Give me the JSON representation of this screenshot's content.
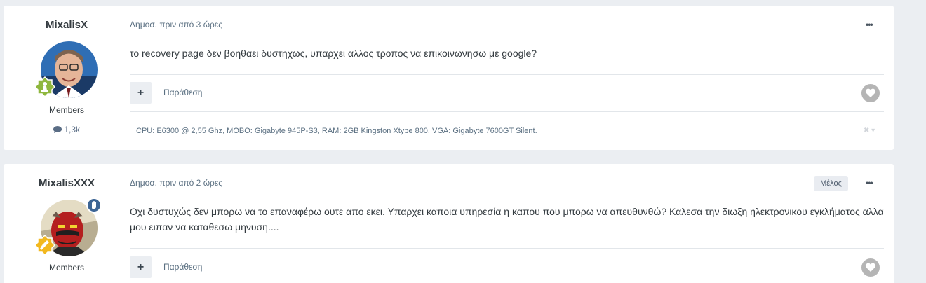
{
  "posts": [
    {
      "author": "MixalisX",
      "group": "Members",
      "post_count": "1,3k",
      "time": "Δημοσ. πριν από 3 ώρες",
      "content": "το recovery page δεν βοηθαει  δυστηχως, υπαρχει αλλος τροπος να επικοινωνησω με google?",
      "quote_label": "Παράθεση",
      "plus_label": "+",
      "menu_label": "•••",
      "signature": "CPU: E6300 @ 2,55 Ghz, MOBO: Gigabyte 945P-S3, RAM: 2GB Kingston Xtype 800, VGA: Gigabyte 7600GT Silent.",
      "signature_ctrl": "✖ ▾"
    },
    {
      "author": "MixalisXXX",
      "group": "Members",
      "time": "Δημοσ. πριν από 2 ώρες",
      "member_tag": "Μέλος",
      "content": "Οχι δυστυχώς  δεν μπορω να το επαναφέρω  ουτε απο εκει. Υπαρχει  καποια υπηρεσία  η καπου που μπορω να απευθυνθώ? Καλεσα την διωξη ηλεκτρονικου εγκλήματος  αλλα μου ειπαν να καταθεσω μηνυση....",
      "quote_label": "Παράθεση",
      "plus_label": "+",
      "menu_label": "•••"
    }
  ],
  "colors": {
    "page_bg": "#ebeef2",
    "card_bg": "#ffffff",
    "rank_green": "#8fb73e",
    "rank_gold": "#f2b81f",
    "staff_blue": "#3d6594",
    "like_grey": "#b5b5b5"
  },
  "icons": {
    "like": "heart-icon",
    "post_count": "comment-icon",
    "rank1": "chess-pawn-icon",
    "rank2": "brush-icon",
    "staff": "hand-icon"
  }
}
